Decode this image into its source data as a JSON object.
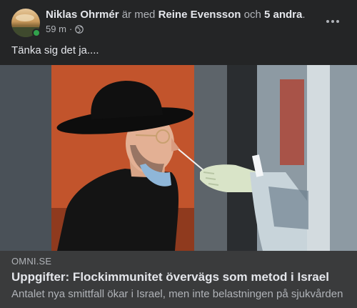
{
  "header": {
    "author": "Niklas Ohrmér",
    "with_text": "är med",
    "tagged": "Reine Evensson",
    "and_text": "och",
    "others": "5 andra",
    "period": ".",
    "time": "59 m",
    "separator": "·",
    "audience_icon": "globe-icon",
    "online_color": "#31a24c"
  },
  "post": {
    "text": "Tänka sig det ja...."
  },
  "link_preview": {
    "domain": "OMNI.SE",
    "title": "Uppgifter: Flockimmunitet övervägs som metod i Israel",
    "description": "Antalet nya smittfall ökar i Israel, men inte belastningen på sjukvården"
  },
  "colors": {
    "background": "#242526",
    "link_box": "#3a3b3c",
    "primary_text": "#e4e6eb",
    "secondary_text": "#b0b3b8"
  }
}
